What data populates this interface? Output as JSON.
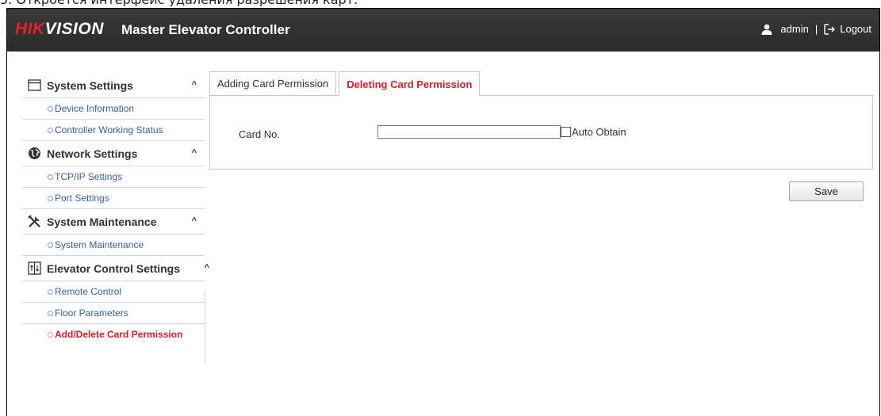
{
  "caption": "5. Откроется интерфейс удаления разрешения карт.",
  "header": {
    "logo_red": "HIK",
    "logo_white": "VISION",
    "title": "Master Elevator Controller",
    "user": "admin",
    "separator": "|",
    "logout": "Logout"
  },
  "sidebar": {
    "groups": [
      {
        "label": "System Settings",
        "icon": "window-icon",
        "items": [
          "Device Information",
          "Controller Working Status"
        ]
      },
      {
        "label": "Network Settings",
        "icon": "globe-icon",
        "items": [
          "TCP/IP Settings",
          "Port Settings"
        ]
      },
      {
        "label": "System Maintenance",
        "icon": "tools-icon",
        "items": [
          "System Maintenance"
        ]
      },
      {
        "label": "Elevator Control Settings",
        "icon": "elevator-icon",
        "items": [
          "Remote Control",
          "Floor Parameters",
          "Add/Delete Card Permission"
        ]
      }
    ],
    "chevron": "^",
    "active_item": "Add/Delete Card Permission"
  },
  "tabs": [
    {
      "label": "Adding Card Permission",
      "active": false
    },
    {
      "label": "Deleting Card Permission",
      "active": true
    }
  ],
  "form": {
    "card_no_label": "Card No.",
    "card_no_value": "",
    "auto_obtain_label": "Auto Obtain",
    "auto_obtain_checked": false,
    "save_label": "Save"
  },
  "colors": {
    "header_bg": "#2f2f2f",
    "brand_red": "#e3202b",
    "active_red": "#d4202a",
    "link_blue": "#3a5f9a"
  }
}
